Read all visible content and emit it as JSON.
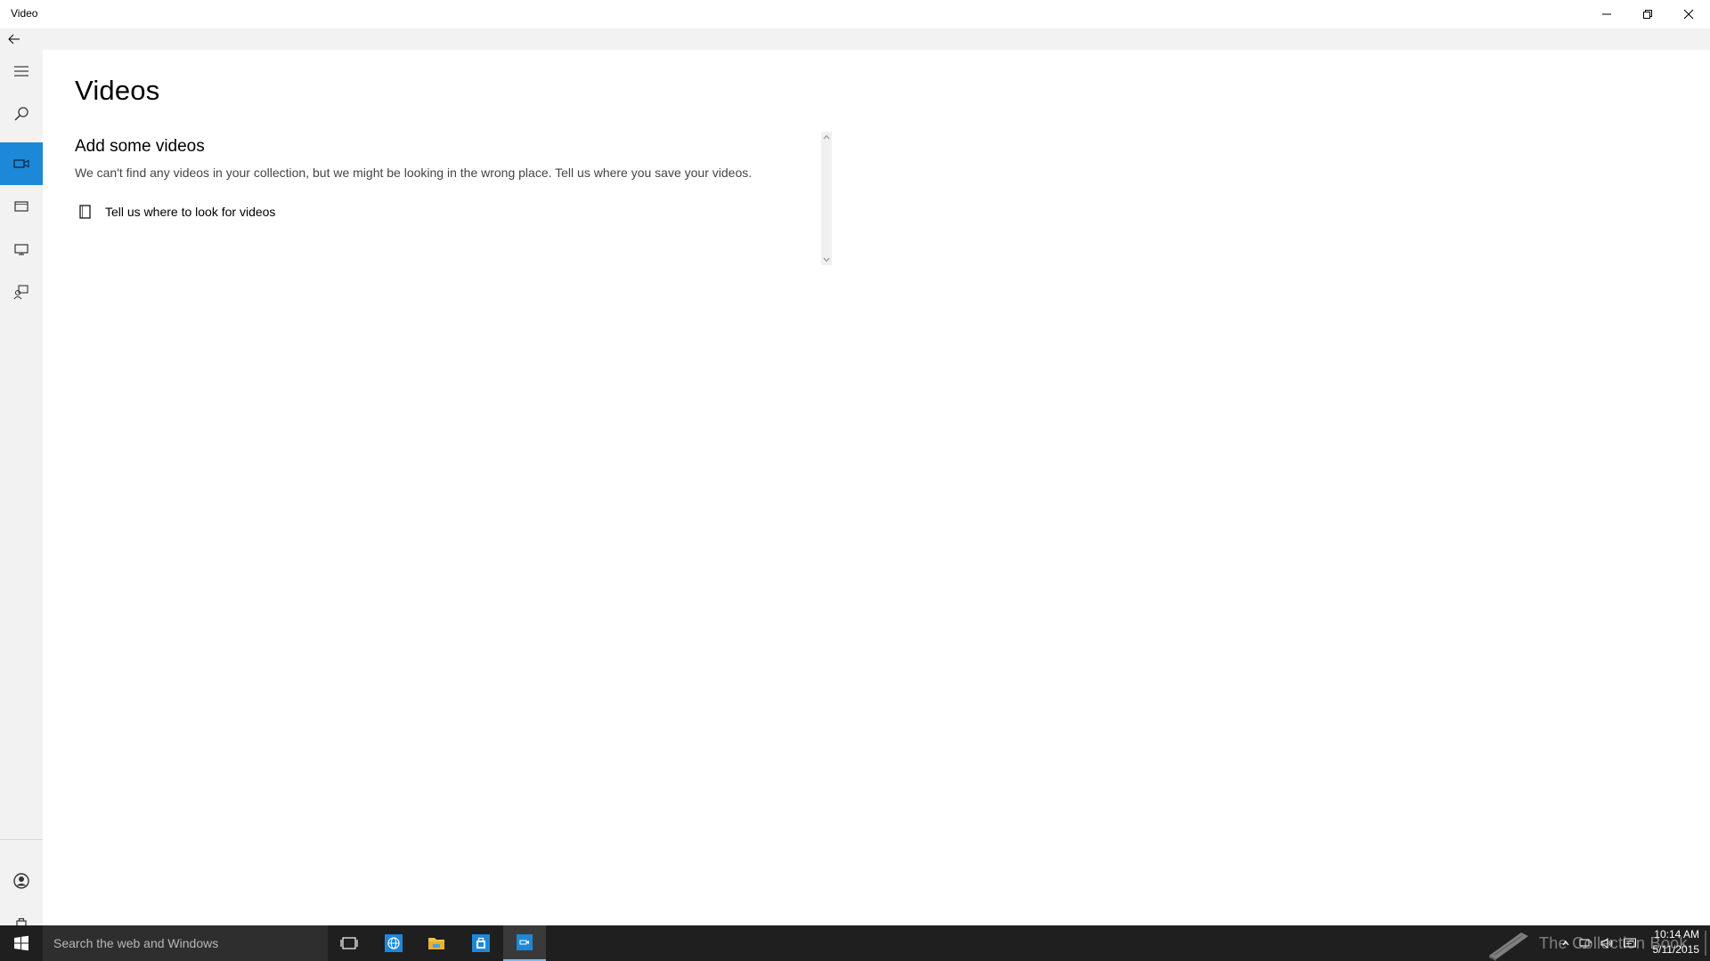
{
  "window": {
    "title": "Video",
    "minimize_icon": "minimize-icon",
    "maximize_icon": "restore-icon",
    "close_icon": "close-icon"
  },
  "nav": {
    "back_icon": "back-arrow-icon",
    "items": [
      {
        "id": "menu",
        "icon": "hamburger-icon"
      },
      {
        "id": "search",
        "icon": "search-icon"
      },
      {
        "id": "videos",
        "icon": "video-camera-icon",
        "active": true
      },
      {
        "id": "movies",
        "icon": "film-icon"
      },
      {
        "id": "tv",
        "icon": "monitor-icon"
      },
      {
        "id": "feedback",
        "icon": "feedback-icon"
      }
    ],
    "bottom": [
      {
        "id": "account",
        "icon": "account-icon"
      },
      {
        "id": "store",
        "icon": "store-bag-icon"
      }
    ]
  },
  "main": {
    "page_title": "Videos",
    "section_title": "Add some videos",
    "section_desc": "We can't find any videos in your collection, but we might be looking in the wrong place. Tell us where you save your videos.",
    "folder_link_label": "Tell us where to look for videos"
  },
  "taskbar": {
    "search_placeholder": "Search the web and Windows",
    "apps": [
      {
        "id": "task-view",
        "icon": "task-view-icon"
      },
      {
        "id": "browser",
        "icon": "globe-icon"
      },
      {
        "id": "file-explorer",
        "icon": "folder-icon"
      },
      {
        "id": "store",
        "icon": "store-icon"
      },
      {
        "id": "video",
        "icon": "video-app-icon",
        "active": true
      }
    ],
    "watermark_text": "The Collection Book",
    "clock_time": "10:14 AM",
    "clock_date": "5/11/2015"
  },
  "colors": {
    "accent": "#1e88d8",
    "taskbar": "#1f1f1f",
    "rail": "#f2f2f2"
  }
}
